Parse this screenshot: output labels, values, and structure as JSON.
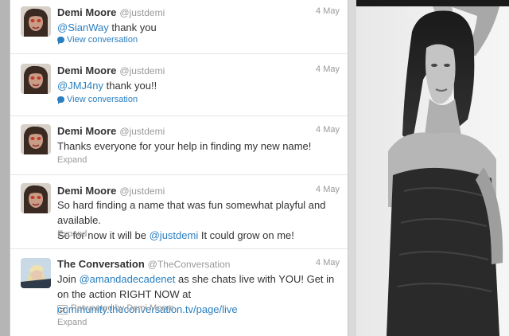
{
  "tweets": [
    {
      "name": "Demi Moore",
      "handle": "@justdemi",
      "date": "4 May",
      "mention": "@SianWay",
      "text": " thank you",
      "action": "View conversation"
    },
    {
      "name": "Demi Moore",
      "handle": "@justdemi",
      "date": "4 May",
      "mention": "@JMJ4ny",
      "text": " thank you!!",
      "action": "View conversation"
    },
    {
      "name": "Demi Moore",
      "handle": "@justdemi",
      "date": "4 May",
      "text": "Thanks everyone for your help in finding my new name!",
      "action": "Expand"
    },
    {
      "name": "Demi Moore",
      "handle": "@justdemi",
      "date": "4 May",
      "text_a": "So hard finding a name that was fun somewhat playful and available.",
      "text_b": "So for now it will be ",
      "mention": "@justdemi",
      "text_c": " It could grow on me!",
      "action": "Expand"
    },
    {
      "name": "The Conversation",
      "handle": "@TheConversation",
      "date": "4 May",
      "text_a": "Join ",
      "mention": "@amandadecadenet",
      "text_b": " as she chats live with YOU! Get in on the action RIGHT NOW at ",
      "link": "community.theconversation.tv/page/live",
      "retweet": "Retweeted by Demi Moore",
      "action": "Expand"
    }
  ],
  "icons": {
    "conversation": "speech-bubble-icon",
    "retweet": "retweet-icon"
  }
}
